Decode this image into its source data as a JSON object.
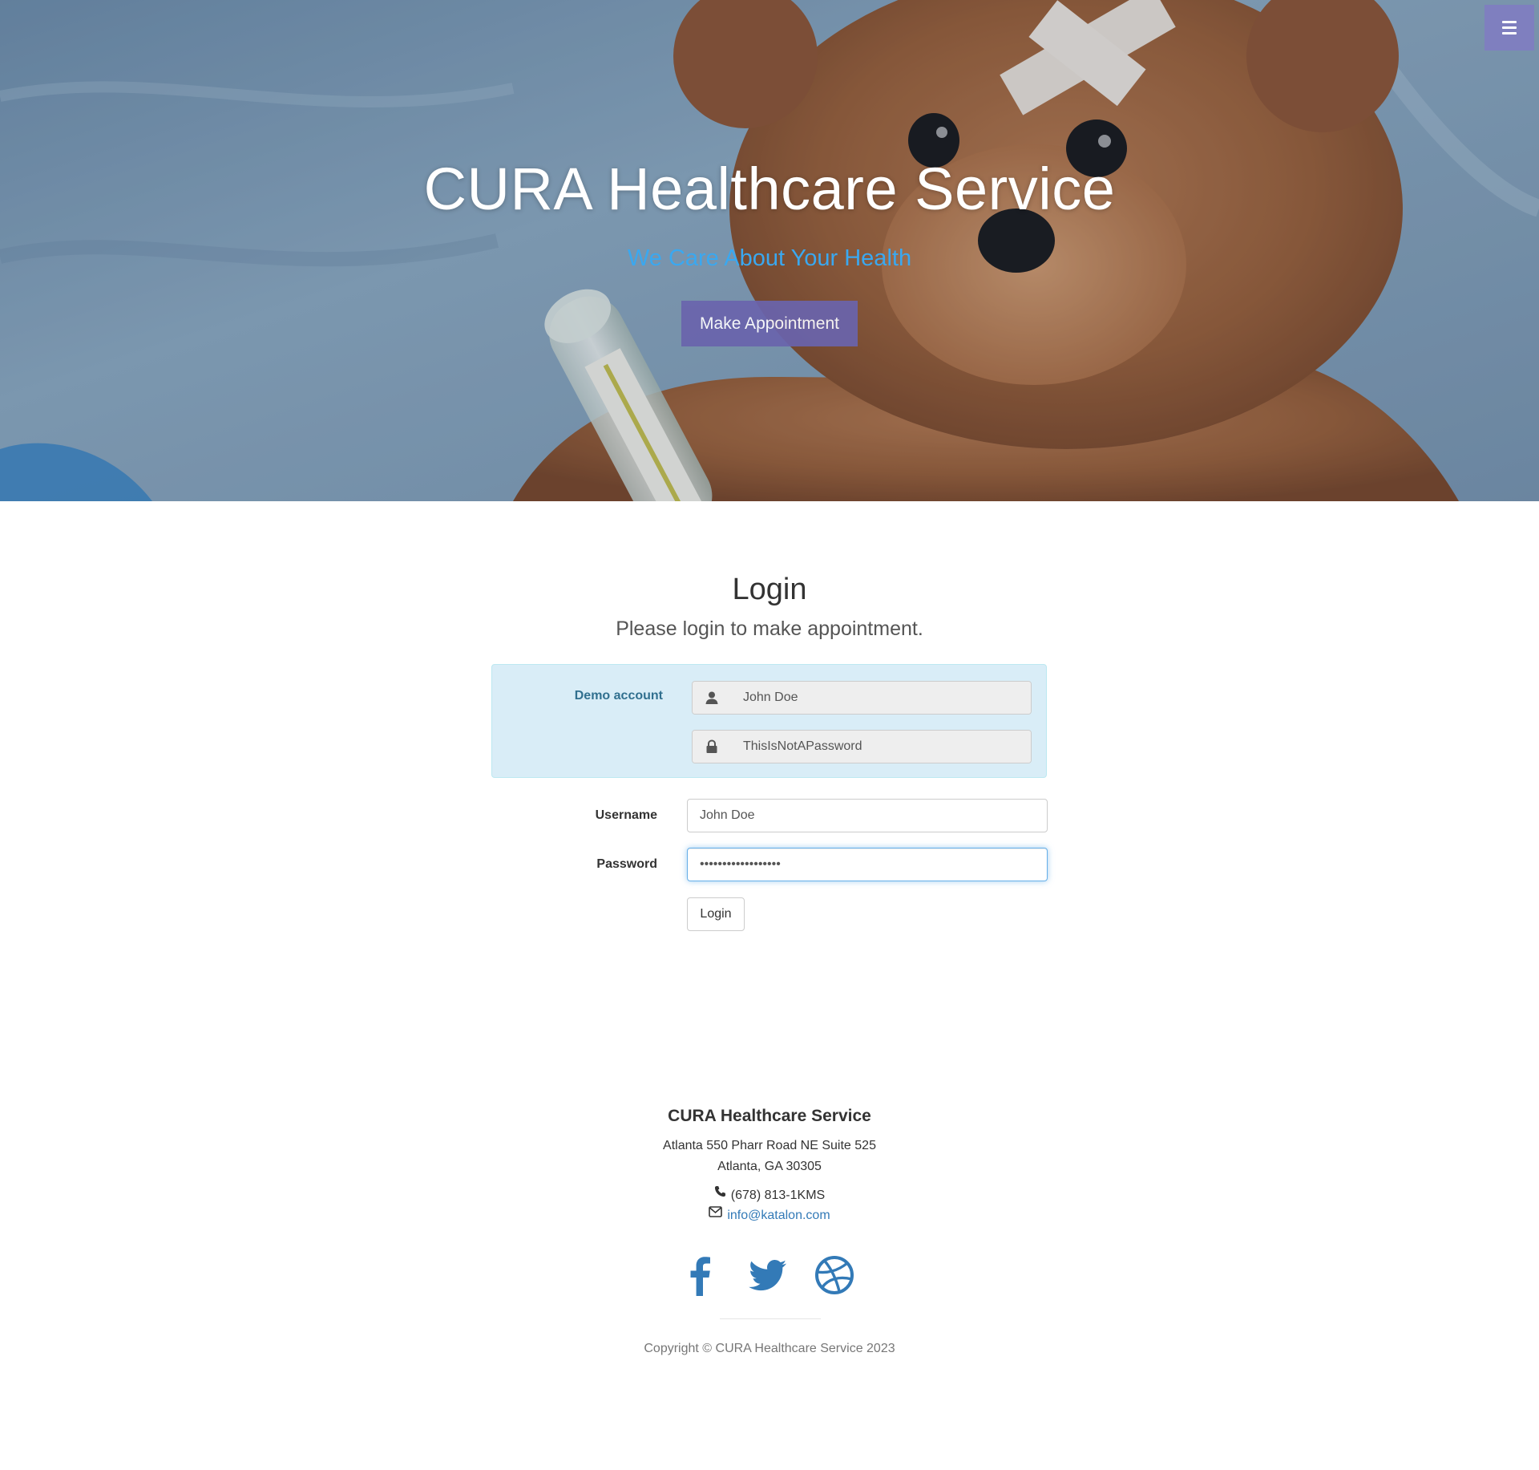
{
  "hero": {
    "title": "CURA Healthcare Service",
    "tagline": "We Care About Your Health",
    "appointment_button": "Make Appointment"
  },
  "login": {
    "title": "Login",
    "subtitle": "Please login to make appointment.",
    "demo": {
      "label": "Demo account",
      "username": "John Doe",
      "password": "ThisIsNotAPassword"
    },
    "username_label": "Username",
    "username_value": "John Doe",
    "password_label": "Password",
    "password_value": "ThisIsNotAPassword",
    "button_label": "Login"
  },
  "footer": {
    "title": "CURA Healthcare Service",
    "address_line1": "Atlanta 550 Pharr Road NE Suite 525",
    "address_line2": "Atlanta, GA 30305",
    "phone": "(678) 813-1KMS",
    "email": "info@katalon.com",
    "copyright": "Copyright © CURA Healthcare Service 2023"
  },
  "icons": {
    "menu": "bars-icon",
    "demo_username": "user-icon",
    "demo_password": "lock-icon",
    "phone": "phone-icon",
    "email": "envelope-icon",
    "social": [
      "facebook-icon",
      "twitter-icon",
      "dribbble-icon"
    ]
  },
  "colors": {
    "menu_button": "#7f7fbf",
    "appointment_button": "#6a64ad",
    "tagline": "#3aa8f0",
    "demo_panel_bg": "#d9edf7",
    "demo_label": "#31708f",
    "link": "#337ab7",
    "social_icon": "#337ab7",
    "focus_border": "#66afe9"
  }
}
